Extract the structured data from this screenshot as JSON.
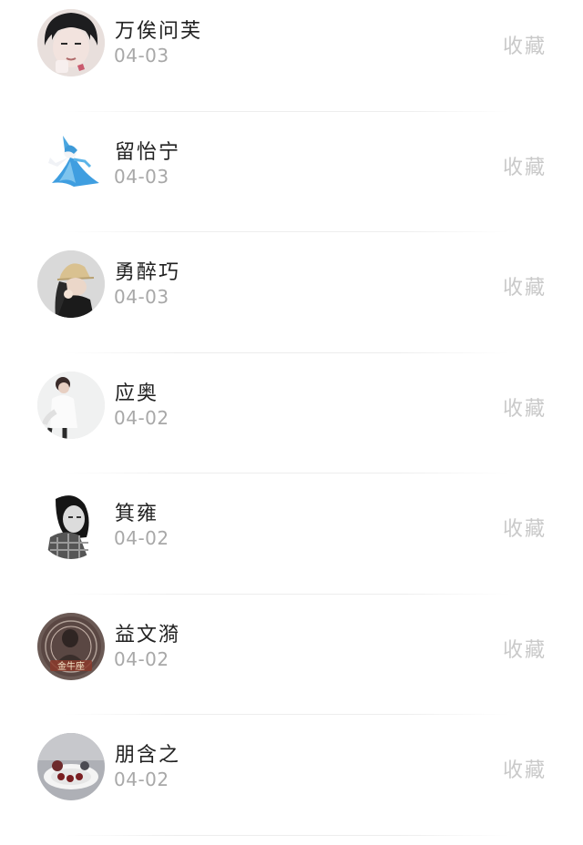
{
  "favorite_label": "收藏",
  "items": [
    {
      "name": "万俟问芙",
      "date": "04-03",
      "avatar_icon": "avatar-boy-face-icon"
    },
    {
      "name": "留怡宁",
      "date": "04-03",
      "avatar_icon": "avatar-gardevoir-icon"
    },
    {
      "name": "勇醉巧",
      "date": "04-03",
      "avatar_icon": "avatar-hat-girl-icon"
    },
    {
      "name": "应奥",
      "date": "04-02",
      "avatar_icon": "avatar-white-shirt-boy-icon"
    },
    {
      "name": "箕雍",
      "date": "04-02",
      "avatar_icon": "avatar-bw-girl-icon"
    },
    {
      "name": "益文漪",
      "date": "04-02",
      "avatar_icon": "avatar-zodiac-badge-icon"
    },
    {
      "name": "朋含之",
      "date": "04-02",
      "avatar_icon": "avatar-dessert-plate-icon"
    }
  ]
}
